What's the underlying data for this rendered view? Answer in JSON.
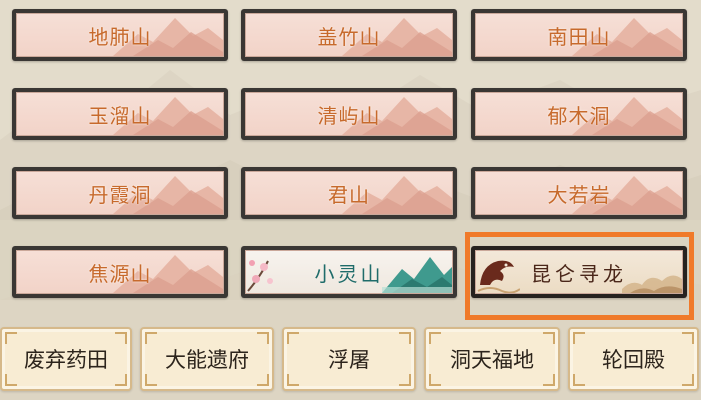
{
  "locations": [
    {
      "label": "地肺山"
    },
    {
      "label": "盖竹山"
    },
    {
      "label": "南田山"
    },
    {
      "label": "玉溜山"
    },
    {
      "label": "清屿山"
    },
    {
      "label": "郁木洞"
    },
    {
      "label": "丹霞洞"
    },
    {
      "label": "君山"
    },
    {
      "label": "大若岩"
    },
    {
      "label": "焦源山"
    }
  ],
  "special": {
    "xiaoling": {
      "label": "小灵山"
    },
    "kunlun": {
      "label": "昆仑寻龙",
      "selected": true
    }
  },
  "tabs": [
    {
      "label": "废弃药田"
    },
    {
      "label": "大能遗府"
    },
    {
      "label": "浮屠"
    },
    {
      "label": "洞天福地"
    },
    {
      "label": "轮回殿"
    }
  ],
  "colors": {
    "highlight": "#f07a2a",
    "card_frame": "#3a3734",
    "card_label": "#c76a2c",
    "xiaoling_label": "#1f6c6a",
    "kunlun_label": "#4a2619"
  }
}
